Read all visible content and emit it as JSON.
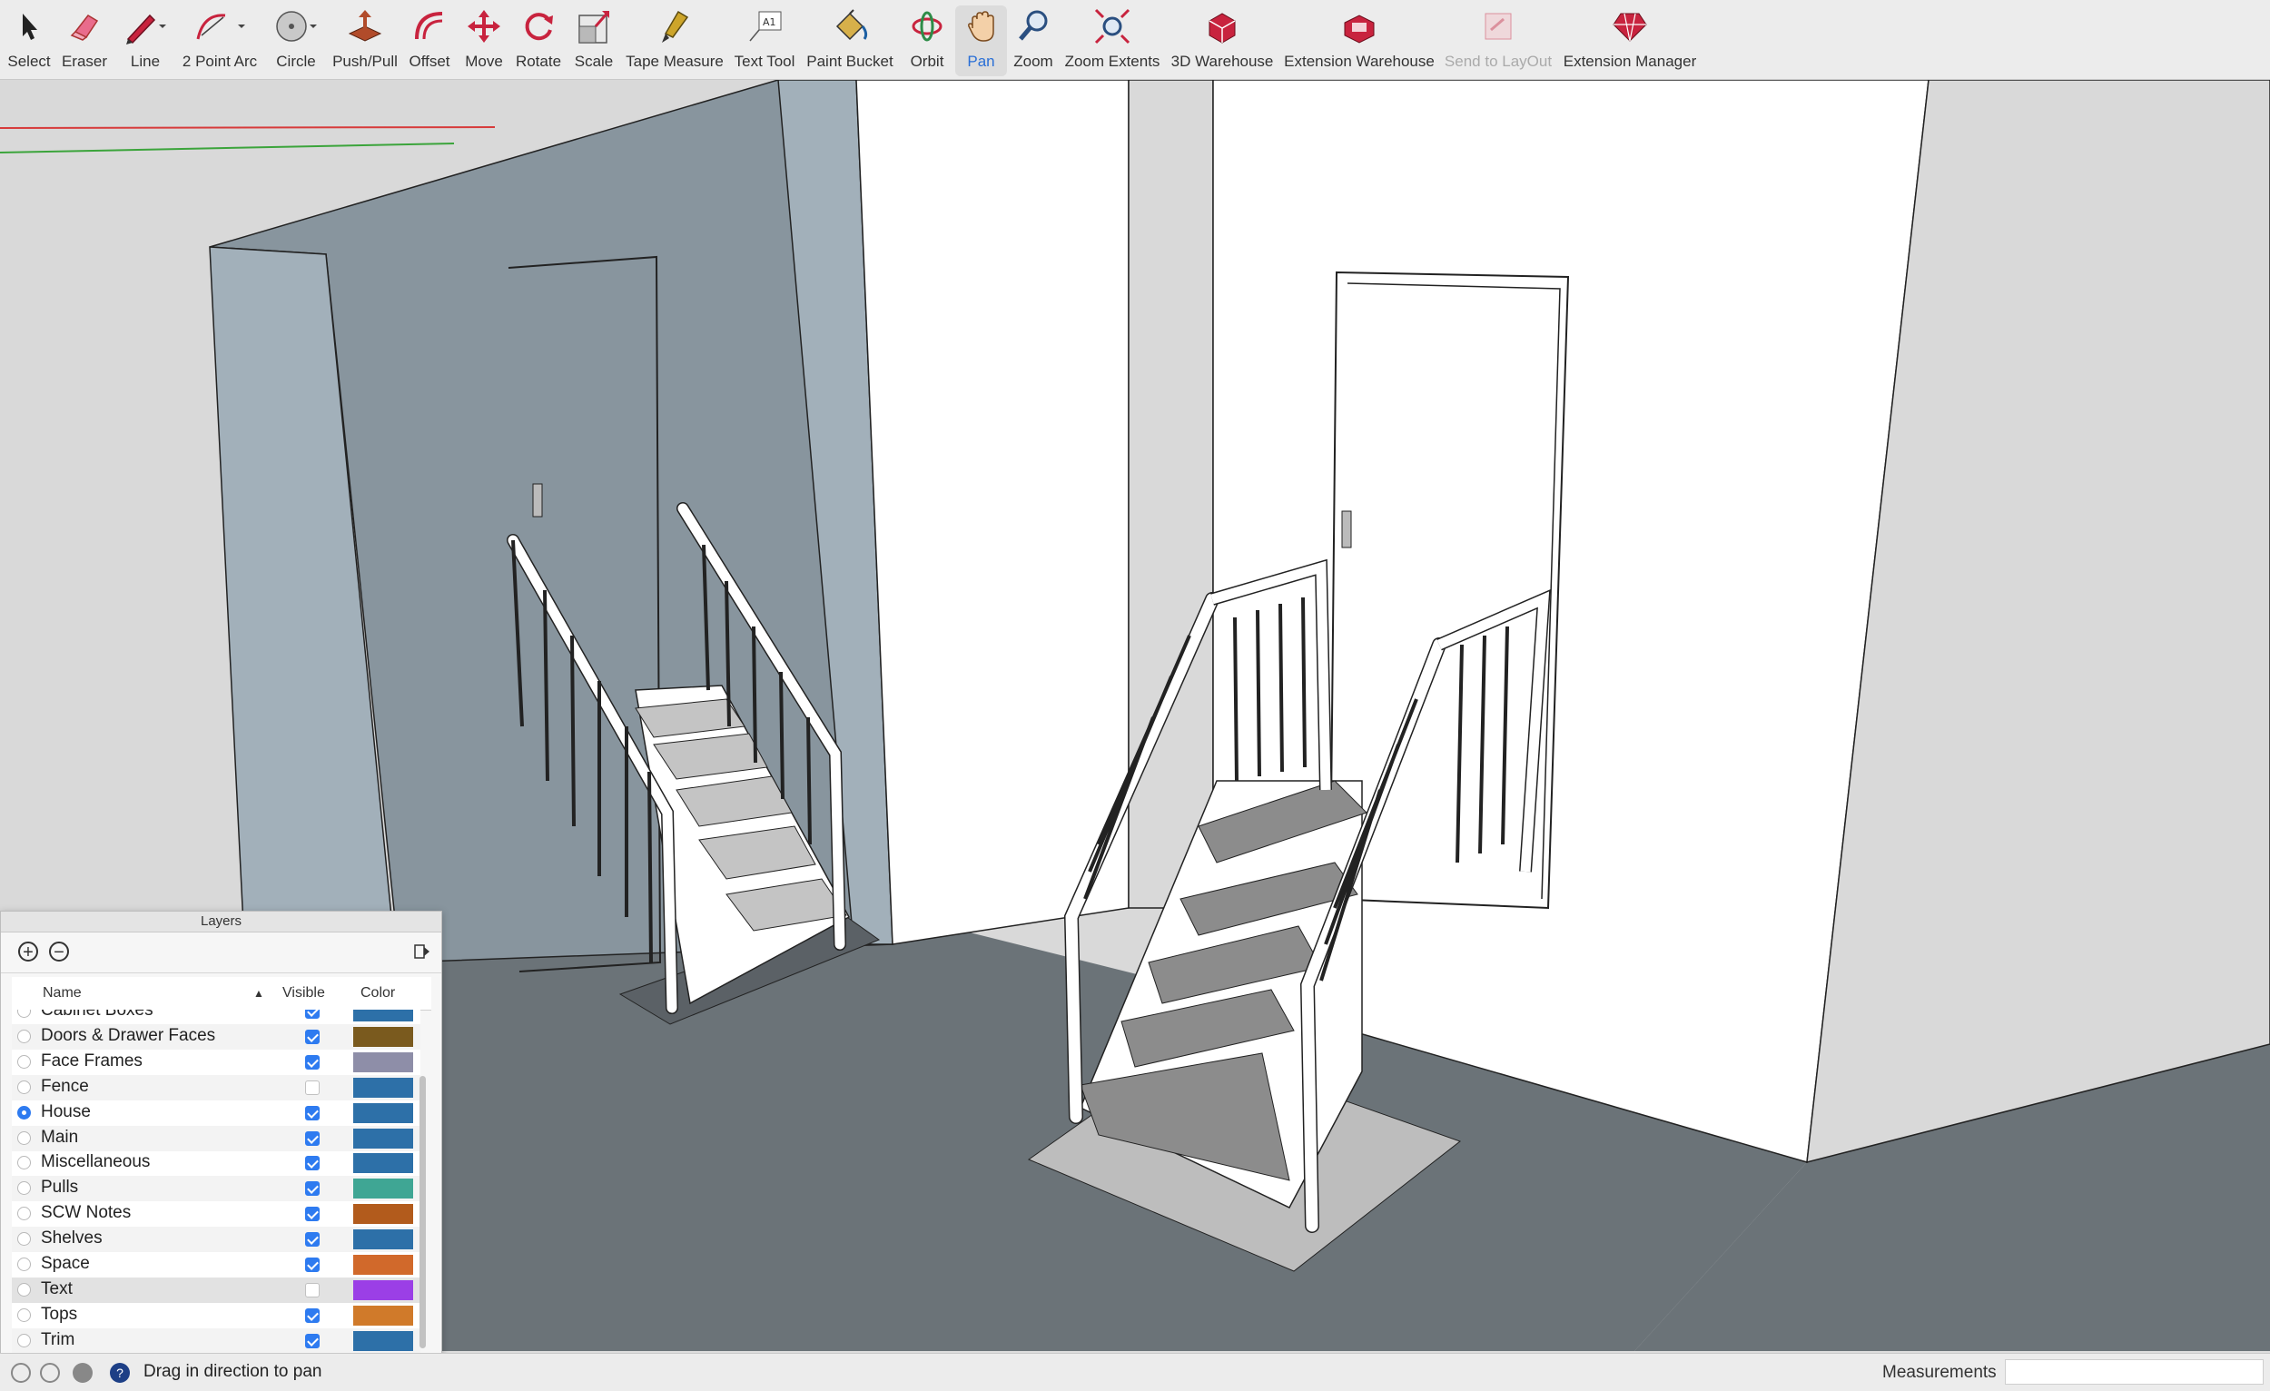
{
  "toolbar": {
    "tools": [
      {
        "label": "Select",
        "icon": "arrow-cursor-icon"
      },
      {
        "label": "Eraser",
        "icon": "eraser-icon"
      },
      {
        "label": "Line",
        "icon": "pencil-icon"
      },
      {
        "label": "2 Point Arc",
        "icon": "arc-icon"
      },
      {
        "label": "Circle",
        "icon": "circle-icon"
      },
      {
        "label": "Push/Pull",
        "icon": "push-pull-icon"
      },
      {
        "label": "Offset",
        "icon": "offset-icon"
      },
      {
        "label": "Move",
        "icon": "move-arrows-icon"
      },
      {
        "label": "Rotate",
        "icon": "rotate-icon"
      },
      {
        "label": "Scale",
        "icon": "scale-icon"
      },
      {
        "label": "Tape Measure",
        "icon": "tape-measure-icon"
      },
      {
        "label": "Text Tool",
        "icon": "text-tool-icon"
      },
      {
        "label": "Paint Bucket",
        "icon": "paint-bucket-icon"
      },
      {
        "label": "Orbit",
        "icon": "orbit-icon"
      },
      {
        "label": "Pan",
        "icon": "pan-hand-icon"
      },
      {
        "label": "Zoom",
        "icon": "zoom-magnifier-icon"
      },
      {
        "label": "Zoom Extents",
        "icon": "zoom-extents-icon"
      },
      {
        "label": "3D Warehouse",
        "icon": "warehouse-icon"
      },
      {
        "label": "Extension Warehouse",
        "icon": "extension-warehouse-icon"
      },
      {
        "label": "Send to LayOut",
        "icon": "send-to-layout-icon"
      },
      {
        "label": "Extension Manager",
        "icon": "extension-manager-icon"
      }
    ],
    "active_tool": "Pan",
    "disabled_tools": [
      "Send to LayOut"
    ]
  },
  "layers_panel": {
    "title": "Layers",
    "columns": {
      "name": "Name",
      "visible": "Visible",
      "color": "Color"
    },
    "rows": [
      {
        "name": "Cabinet Boxes",
        "active": false,
        "visible": true,
        "color": "#2d70a8"
      },
      {
        "name": "Doors & Drawer Faces",
        "active": false,
        "visible": true,
        "color": "#7a5a1e"
      },
      {
        "name": "Face Frames",
        "active": false,
        "visible": true,
        "color": "#8e8ea8"
      },
      {
        "name": "Fence",
        "active": false,
        "visible": false,
        "color": "#2d70a8"
      },
      {
        "name": "House",
        "active": true,
        "visible": true,
        "color": "#2d70a8"
      },
      {
        "name": "Main",
        "active": false,
        "visible": true,
        "color": "#2d70a8"
      },
      {
        "name": "Miscellaneous",
        "active": false,
        "visible": true,
        "color": "#2d70a8"
      },
      {
        "name": "Pulls",
        "active": false,
        "visible": true,
        "color": "#3fa694"
      },
      {
        "name": "SCW Notes",
        "active": false,
        "visible": true,
        "color": "#b25b1c"
      },
      {
        "name": "Shelves",
        "active": false,
        "visible": true,
        "color": "#2d70a8"
      },
      {
        "name": "Space",
        "active": false,
        "visible": true,
        "color": "#d1692b"
      },
      {
        "name": "Text",
        "active": false,
        "visible": false,
        "color": "#9b3fe6"
      },
      {
        "name": "Tops",
        "active": false,
        "visible": true,
        "color": "#d07a2a"
      },
      {
        "name": "Trim",
        "active": false,
        "visible": true,
        "color": "#2d70a8"
      }
    ],
    "selected_row": "Text"
  },
  "statusbar": {
    "message": "Drag in direction to pan",
    "measurements_label": "Measurements",
    "measurements_value": ""
  }
}
